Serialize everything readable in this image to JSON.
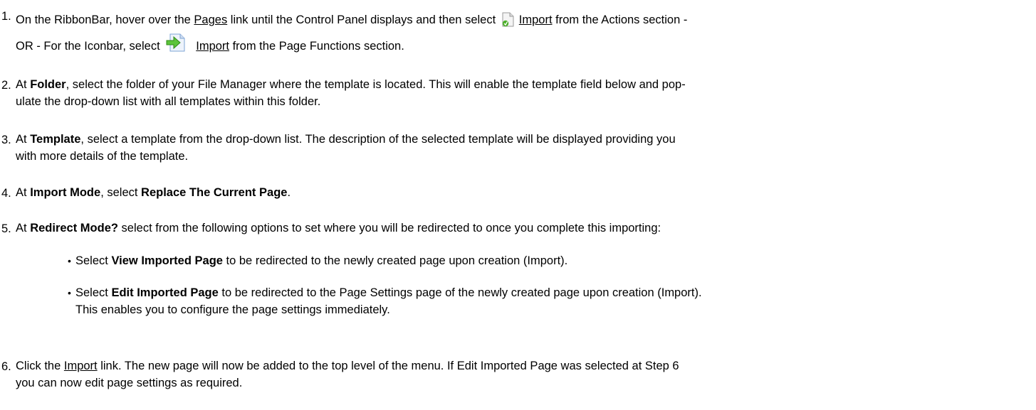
{
  "steps": {
    "s1": {
      "num": "1.",
      "a": "On the RibbonBar, hover over the ",
      "pages_link": "Pages",
      "b": " link until the Control Panel displays and then select ",
      "import_link": "Import",
      "c": " from the Actions section -",
      "d": "OR - For the Iconbar, select ",
      "import_link2": "Import",
      "e": " from the Page Functions section."
    },
    "s2": {
      "num": "2.",
      "a": "At ",
      "bold": "Folder",
      "b": ", select the folder of your File Manager where the template is located. This will enable the template field below and pop-",
      "c": "ulate the drop-down list with all templates within this folder."
    },
    "s3": {
      "num": "3.",
      "a": "At ",
      "bold": "Template",
      "b": ", select a template from the drop-down list. The description of the selected template will be displayed providing you",
      "c": "with more details of the template."
    },
    "s4": {
      "num": "4.",
      "a": "At ",
      "bold1": "Import Mode",
      "b": ", select ",
      "bold2": "Replace The Current Page",
      "c": "."
    },
    "s5": {
      "num": "5.",
      "a": "At ",
      "bold": "Redirect Mode?",
      "b": " select from the following options to set where you will be redirected to once you complete this importing:",
      "bullet": "•",
      "opt1": {
        "a": "Select ",
        "bold": "View Imported Page",
        "b": " to be redirected to the newly created page upon creation (Import)."
      },
      "opt2": {
        "a": "Select ",
        "bold": "Edit Imported Page",
        "b": " to be redirected to the Page Settings page of the newly created page upon creation (Import).",
        "c": "This enables you to configure the page settings immediately."
      }
    },
    "s6": {
      "num": "6.",
      "a": "Click the ",
      "import_link": "Import",
      "b": " link. The new page will now be added to the top level of the menu. If Edit Imported Page was selected at Step 6",
      "c": "you can now edit page settings as required."
    }
  },
  "icons": {
    "import_page_icon": "import-page-icon",
    "import_arrow_icon": "import-arrow-icon",
    "accent_green": "#4caf2a",
    "accent_blue": "#2f7fd8"
  }
}
